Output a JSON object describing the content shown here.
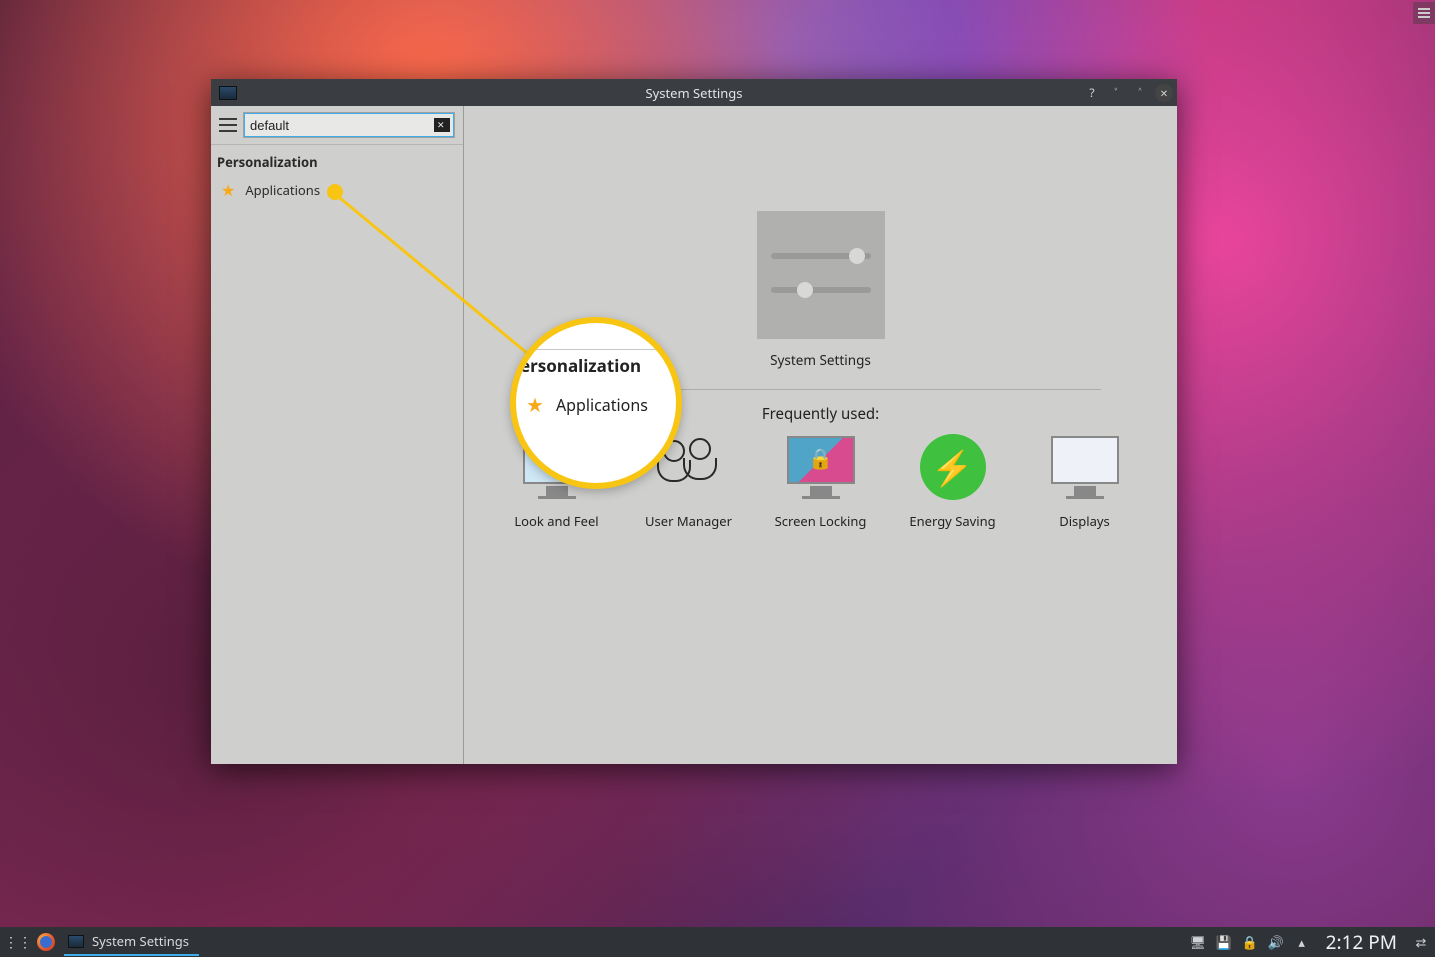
{
  "window": {
    "title": "System Settings"
  },
  "search": {
    "value": "default"
  },
  "sidebar": {
    "section": "Personalization",
    "items": [
      {
        "label": "Applications"
      }
    ]
  },
  "main": {
    "hero_label": "System Settings",
    "frequent_title": "Frequently used:",
    "frequent": [
      {
        "label": "Look and Feel"
      },
      {
        "label": "User Manager"
      },
      {
        "label": "Screen Locking"
      },
      {
        "label": "Energy Saving"
      },
      {
        "label": "Displays"
      }
    ]
  },
  "magnifier": {
    "header": "ersonalization",
    "item": "Applications"
  },
  "taskbar": {
    "task_label": "System Settings",
    "clock": "2:12 PM"
  }
}
